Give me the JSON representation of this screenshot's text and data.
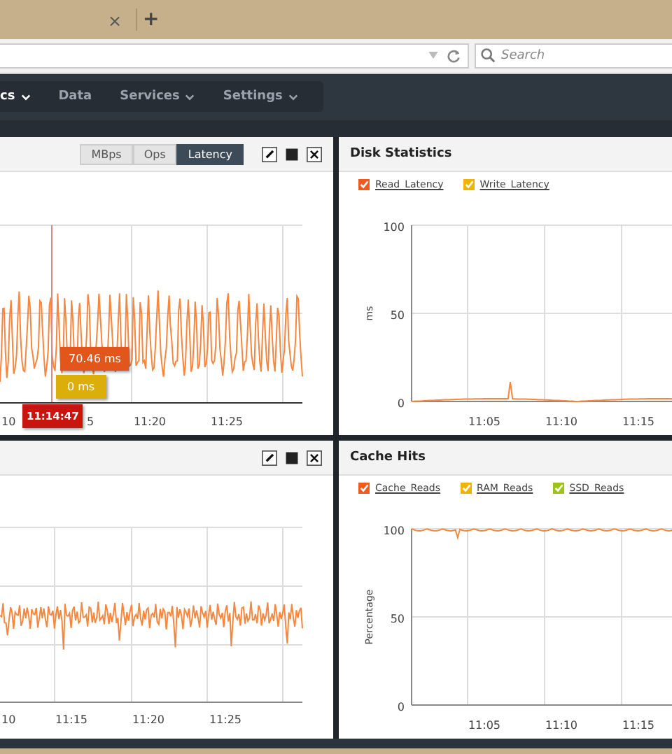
{
  "browser": {
    "tab_close": "×",
    "new_tab": "+",
    "search_placeholder": "Search"
  },
  "nav": [
    {
      "label": "cs",
      "dropdown": true,
      "selected": true
    },
    {
      "label": "Data",
      "dropdown": false,
      "selected": false
    },
    {
      "label": "Services",
      "dropdown": true,
      "selected": false
    },
    {
      "label": "Settings",
      "dropdown": true,
      "selected": false
    }
  ],
  "panels": [
    {
      "kind": "latency",
      "segments": [
        {
          "label": "MBps",
          "selected": false
        },
        {
          "label": "Ops",
          "selected": false
        },
        {
          "label": "Latency",
          "selected": true
        }
      ],
      "tooltips": [
        {
          "text": "70.46 ms",
          "color": "#e2561c"
        },
        {
          "text": "0 ms",
          "color": "#dcae0a"
        },
        {
          "text": "11:14:47",
          "color": "#c8160f"
        }
      ],
      "x_ticks": [
        "10",
        "5",
        "11:20",
        "11:25"
      ]
    },
    {
      "kind": "stats",
      "title": "Disk Statistics",
      "legend": [
        {
          "label": "Read_Latency",
          "checked": true,
          "color": "#f05a1e"
        },
        {
          "label": "Write_Latency",
          "checked": true,
          "color": "#f0b400"
        }
      ],
      "y_label": "ms",
      "y_ticks": [
        "100",
        "50",
        "0"
      ],
      "x_ticks": [
        "11:05",
        "11:10",
        "11:15"
      ]
    },
    {
      "kind": "plain",
      "x_ticks": [
        "10",
        "11:15",
        "11:20",
        "11:25"
      ]
    },
    {
      "kind": "stats",
      "title": "Cache Hits",
      "legend": [
        {
          "label": "Cache_Reads",
          "checked": true,
          "color": "#f05a1e"
        },
        {
          "label": "RAM_Reads",
          "checked": true,
          "color": "#f0b400"
        },
        {
          "label": "SSD_Reads",
          "checked": true,
          "color": "#9cc31a"
        }
      ],
      "y_label": "Percentage",
      "y_ticks": [
        "100",
        "50",
        "0"
      ],
      "x_ticks": [
        "11:05",
        "11:10",
        "11:15"
      ]
    }
  ]
}
